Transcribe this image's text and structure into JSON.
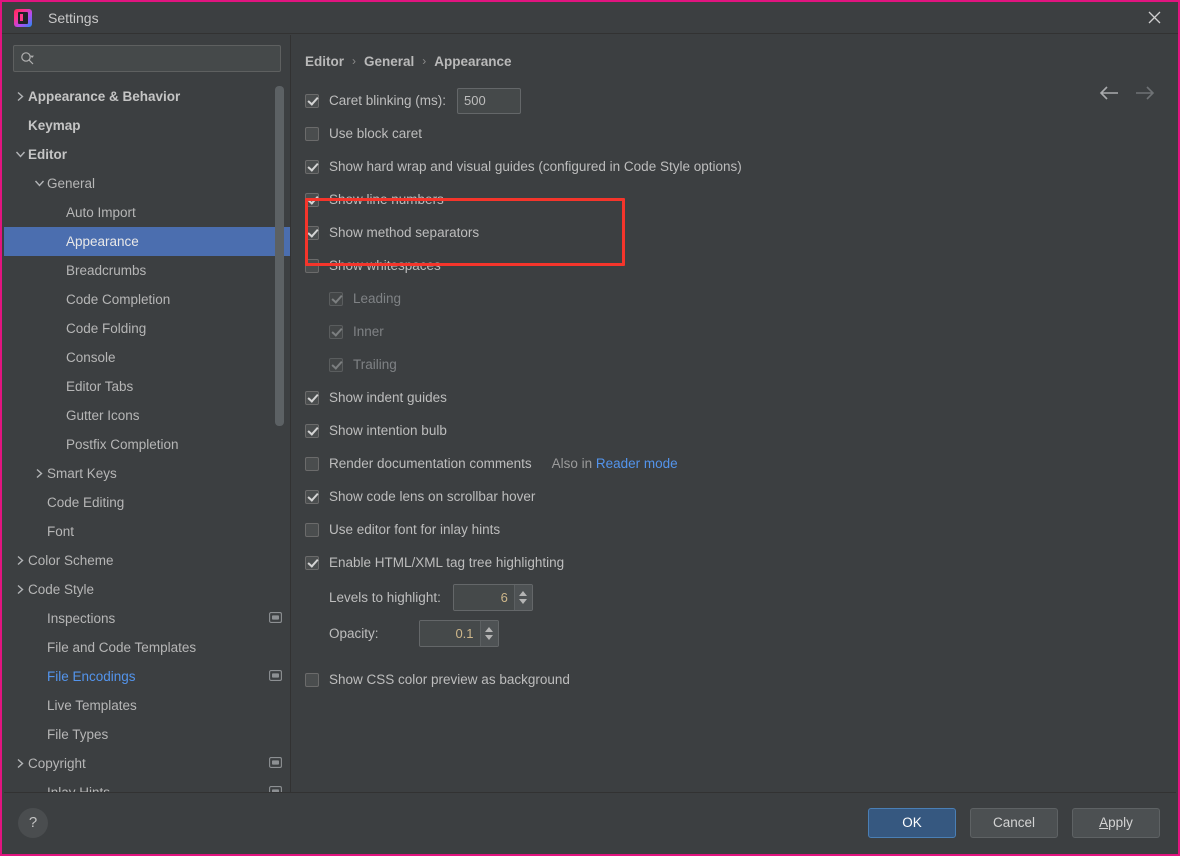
{
  "window": {
    "title": "Settings",
    "logo_icon": "intellij-idea-logo",
    "close_icon": "close-icon"
  },
  "search": {
    "value": "",
    "placeholder": "",
    "icon": "search-icon",
    "dropdown_icon": "chevron-down-icon"
  },
  "sidebar": {
    "items": [
      {
        "label": "Appearance & Behavior",
        "indent": 0,
        "arrow": "collapsed",
        "bold": true,
        "selected": false,
        "link": false,
        "config_icon": false
      },
      {
        "label": "Keymap",
        "indent": 0,
        "arrow": "none",
        "bold": true,
        "selected": false,
        "link": false,
        "config_icon": false
      },
      {
        "label": "Editor",
        "indent": 0,
        "arrow": "expanded",
        "bold": true,
        "selected": false,
        "link": false,
        "config_icon": false
      },
      {
        "label": "General",
        "indent": 1,
        "arrow": "expanded",
        "bold": false,
        "selected": false,
        "link": false,
        "config_icon": false
      },
      {
        "label": "Auto Import",
        "indent": 2,
        "arrow": "none",
        "bold": false,
        "selected": false,
        "link": false,
        "config_icon": false
      },
      {
        "label": "Appearance",
        "indent": 2,
        "arrow": "none",
        "bold": false,
        "selected": true,
        "link": false,
        "config_icon": false
      },
      {
        "label": "Breadcrumbs",
        "indent": 2,
        "arrow": "none",
        "bold": false,
        "selected": false,
        "link": false,
        "config_icon": false
      },
      {
        "label": "Code Completion",
        "indent": 2,
        "arrow": "none",
        "bold": false,
        "selected": false,
        "link": false,
        "config_icon": false
      },
      {
        "label": "Code Folding",
        "indent": 2,
        "arrow": "none",
        "bold": false,
        "selected": false,
        "link": false,
        "config_icon": false
      },
      {
        "label": "Console",
        "indent": 2,
        "arrow": "none",
        "bold": false,
        "selected": false,
        "link": false,
        "config_icon": false
      },
      {
        "label": "Editor Tabs",
        "indent": 2,
        "arrow": "none",
        "bold": false,
        "selected": false,
        "link": false,
        "config_icon": false
      },
      {
        "label": "Gutter Icons",
        "indent": 2,
        "arrow": "none",
        "bold": false,
        "selected": false,
        "link": false,
        "config_icon": false
      },
      {
        "label": "Postfix Completion",
        "indent": 2,
        "arrow": "none",
        "bold": false,
        "selected": false,
        "link": false,
        "config_icon": false
      },
      {
        "label": "Smart Keys",
        "indent": 1,
        "arrow": "collapsed",
        "bold": false,
        "selected": false,
        "link": false,
        "config_icon": false
      },
      {
        "label": "Code Editing",
        "indent": 1,
        "arrow": "none",
        "bold": false,
        "selected": false,
        "link": false,
        "config_icon": false
      },
      {
        "label": "Font",
        "indent": 1,
        "arrow": "none",
        "bold": false,
        "selected": false,
        "link": false,
        "config_icon": false
      },
      {
        "label": "Color Scheme",
        "indent": 0,
        "arrow": "collapsed",
        "bold": false,
        "selected": false,
        "link": false,
        "config_icon": false
      },
      {
        "label": "Code Style",
        "indent": 0,
        "arrow": "collapsed",
        "bold": false,
        "selected": false,
        "link": false,
        "config_icon": false
      },
      {
        "label": "Inspections",
        "indent": 1,
        "arrow": "none",
        "bold": false,
        "selected": false,
        "link": false,
        "config_icon": true
      },
      {
        "label": "File and Code Templates",
        "indent": 1,
        "arrow": "none",
        "bold": false,
        "selected": false,
        "link": false,
        "config_icon": false
      },
      {
        "label": "File Encodings",
        "indent": 1,
        "arrow": "none",
        "bold": false,
        "selected": false,
        "link": true,
        "config_icon": true
      },
      {
        "label": "Live Templates",
        "indent": 1,
        "arrow": "none",
        "bold": false,
        "selected": false,
        "link": false,
        "config_icon": false
      },
      {
        "label": "File Types",
        "indent": 1,
        "arrow": "none",
        "bold": false,
        "selected": false,
        "link": false,
        "config_icon": false
      },
      {
        "label": "Copyright",
        "indent": 0,
        "arrow": "collapsed",
        "bold": false,
        "selected": false,
        "link": false,
        "config_icon": true
      },
      {
        "label": "Inlay Hints",
        "indent": 1,
        "arrow": "none",
        "bold": false,
        "selected": false,
        "link": false,
        "config_icon": true
      }
    ]
  },
  "breadcrumb": {
    "parts": [
      "Editor",
      "General",
      "Appearance"
    ],
    "separator": "›",
    "back_icon": "arrow-left-icon",
    "forward_icon": "arrow-right-icon"
  },
  "settings": {
    "caret_blinking": {
      "label": "Caret blinking (ms):",
      "checked": true,
      "value": "500"
    },
    "use_block_caret": {
      "label": "Use block caret",
      "checked": false
    },
    "show_hard_wrap": {
      "label": "Show hard wrap and visual guides (configured in Code Style options)",
      "checked": true
    },
    "show_line_numbers": {
      "label": "Show line numbers",
      "checked": true
    },
    "show_method_separators": {
      "label": "Show method separators",
      "checked": true
    },
    "show_whitespaces": {
      "label": "Show whitespaces",
      "checked": false
    },
    "ws_leading": {
      "label": "Leading",
      "checked": true,
      "disabled": true
    },
    "ws_inner": {
      "label": "Inner",
      "checked": true,
      "disabled": true
    },
    "ws_trailing": {
      "label": "Trailing",
      "checked": true,
      "disabled": true
    },
    "show_indent_guides": {
      "label": "Show indent guides",
      "checked": true
    },
    "show_intention_bulb": {
      "label": "Show intention bulb",
      "checked": true
    },
    "render_doc_comments": {
      "label": "Render documentation comments",
      "checked": false,
      "hint_prefix": "Also in ",
      "hint_link": "Reader mode"
    },
    "show_code_lens": {
      "label": "Show code lens on scrollbar hover",
      "checked": true
    },
    "use_editor_font_inlay": {
      "label": "Use editor font for inlay hints",
      "checked": false
    },
    "enable_tag_tree_highlighting": {
      "label": "Enable HTML/XML tag tree highlighting",
      "checked": true
    },
    "levels_to_highlight": {
      "label": "Levels to highlight:",
      "value": "6"
    },
    "opacity": {
      "label": "Opacity:",
      "value": "0.1"
    },
    "show_css_color_preview": {
      "label": "Show CSS color preview as background",
      "checked": false
    }
  },
  "annotation": {
    "highlight_color": "#f5352b",
    "targets": [
      "Show line numbers",
      "Show method separators"
    ]
  },
  "footer": {
    "help_label": "?",
    "help_icon": "question-mark-icon",
    "ok": "OK",
    "cancel": "Cancel",
    "apply_mnemonic": "A",
    "apply_rest": "pply"
  },
  "colors": {
    "accent_selection": "#4b6eaf",
    "primary_button": "#365880",
    "link": "#5394ec",
    "window_border": "#e1147f",
    "background": "#3c3f41",
    "spinner_value": "#cdb68a"
  }
}
